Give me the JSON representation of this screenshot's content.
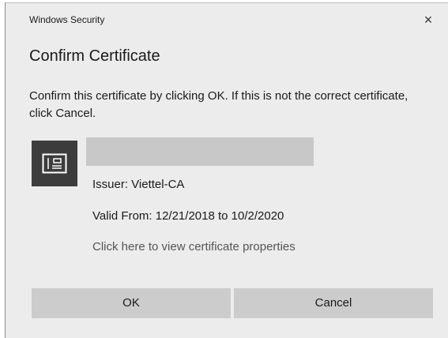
{
  "window": {
    "title": "Windows Security",
    "close_glyph": "×"
  },
  "dialog": {
    "heading": "Confirm Certificate",
    "message": "Confirm this certificate by clicking OK. If this is not the correct certificate, click Cancel."
  },
  "certificate": {
    "icon": "certificate-icon",
    "name": "",
    "issuer": "Issuer: Viettel-CA",
    "valid_from": "Valid From: 12/21/2018 to 10/2/2020",
    "properties_link": "Click here to view certificate properties"
  },
  "buttons": {
    "ok_label": "OK",
    "cancel_label": "Cancel"
  },
  "colors": {
    "dialog_background": "#ececec",
    "button_background": "#cccccc",
    "icon_tile": "#3c3c3c",
    "link_text": "#555555"
  }
}
